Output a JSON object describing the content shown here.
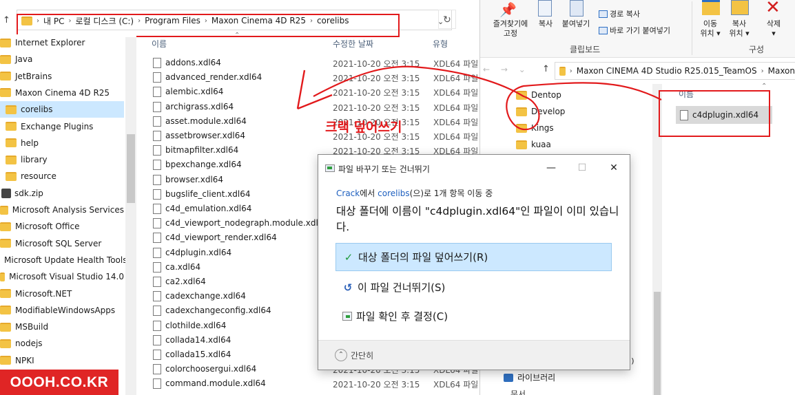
{
  "left": {
    "breadcrumbs": [
      "내 PC",
      "로컬 디스크 (C:)",
      "Program Files",
      "Maxon Cinema 4D R25",
      "corelibs"
    ],
    "search_partial": "",
    "nav_items": [
      {
        "label": "Internet Explorer",
        "selected": false
      },
      {
        "label": "Java",
        "selected": false
      },
      {
        "label": "JetBrains",
        "selected": false
      },
      {
        "label": "Maxon Cinema 4D R25",
        "selected": false
      },
      {
        "label": "corelibs",
        "selected": true
      },
      {
        "label": "Exchange Plugins",
        "selected": false
      },
      {
        "label": "help",
        "selected": false
      },
      {
        "label": "library",
        "selected": false
      },
      {
        "label": "resource",
        "selected": false
      },
      {
        "label": "sdk.zip",
        "selected": false
      },
      {
        "label": "Microsoft Analysis Services",
        "selected": false
      },
      {
        "label": "Microsoft Office",
        "selected": false
      },
      {
        "label": "Microsoft SQL Server",
        "selected": false
      },
      {
        "label": "Microsoft Update Health Tools",
        "selected": false
      },
      {
        "label": "Microsoft Visual Studio 14.0",
        "selected": false
      },
      {
        "label": "Microsoft.NET",
        "selected": false
      },
      {
        "label": "ModifiableWindowsApps",
        "selected": false
      },
      {
        "label": "MSBuild",
        "selected": false
      },
      {
        "label": "nodejs",
        "selected": false
      },
      {
        "label": "NPKI",
        "selected": false
      }
    ],
    "columns": {
      "name": "이름",
      "date": "수정한 날짜",
      "type": "유형"
    },
    "files": [
      {
        "name": "addons.xdl64",
        "date": "2021-10-20 오전 3:15",
        "type": "XDL64 파일"
      },
      {
        "name": "advanced_render.xdl64",
        "date": "2021-10-20 오전 3:15",
        "type": "XDL64 파일"
      },
      {
        "name": "alembic.xdl64",
        "date": "2021-10-20 오전 3:15",
        "type": "XDL64 파일"
      },
      {
        "name": "archigrass.xdl64",
        "date": "2021-10-20 오전 3:15",
        "type": "XDL64 파일"
      },
      {
        "name": "asset.module.xdl64",
        "date": "2021-10-20 오전 3:15",
        "type": "XDL64 파일"
      },
      {
        "name": "assetbrowser.xdl64",
        "date": "2021-10-20 오전 3:15",
        "type": "XDL64 파일"
      },
      {
        "name": "bitmapfilter.xdl64",
        "date": "2021-10-20 오전 3:15",
        "type": "XDL64 파일"
      },
      {
        "name": "bpexchange.xdl64",
        "date": "",
        "type": ""
      },
      {
        "name": "browser.xdl64",
        "date": "",
        "type": ""
      },
      {
        "name": "bugslife_client.xdl64",
        "date": "",
        "type": ""
      },
      {
        "name": "c4d_emulation.xdl64",
        "date": "",
        "type": ""
      },
      {
        "name": "c4d_viewport_nodegraph.module.xdl64",
        "date": "",
        "type": ""
      },
      {
        "name": "c4d_viewport_render.xdl64",
        "date": "",
        "type": ""
      },
      {
        "name": "c4dplugin.xdl64",
        "date": "",
        "type": ""
      },
      {
        "name": "ca.xdl64",
        "date": "",
        "type": ""
      },
      {
        "name": "ca2.xdl64",
        "date": "",
        "type": ""
      },
      {
        "name": "cadexchange.xdl64",
        "date": "",
        "type": ""
      },
      {
        "name": "cadexchangeconfig.xdl64",
        "date": "",
        "type": ""
      },
      {
        "name": "clothilde.xdl64",
        "date": "",
        "type": ""
      },
      {
        "name": "collada14.xdl64",
        "date": "",
        "type": ""
      },
      {
        "name": "collada15.xdl64",
        "date": "",
        "type": ""
      },
      {
        "name": "colorchoosergui.xdl64",
        "date": "2021-10-20 오전 3:15",
        "type": "XDL64 파일"
      },
      {
        "name": "command.module.xdl64",
        "date": "2021-10-20 오전 3:15",
        "type": "XDL64 파일"
      }
    ]
  },
  "right": {
    "ribbon": {
      "pin_label": "즐겨찾기에\n고정",
      "copy_label": "복사",
      "paste_label": "붙여넣기",
      "copy_path_label": "경로 복사",
      "paste_shortcut_label": "바로 가기 붙여넣기",
      "move_to_label": "이동\n위치 ▾",
      "copy_to_label": "복사\n위치 ▾",
      "delete_label": "삭제\n▾",
      "clipboard_group": "클립보드",
      "organize_group": "구성"
    },
    "breadcrumbs": [
      "Maxon CINEMA 4D Studio R25.015_TeamOS",
      "Maxon"
    ],
    "nav_items": [
      "Dentop",
      "Develop",
      "Kings",
      "kuaa"
    ],
    "list_header": "이름",
    "selected_file": "c4dplugin.xdl64",
    "library_label": "라이브러리",
    "drive_label": "Z:)",
    "last_item": "문서"
  },
  "annotation": {
    "text": "크랙 덮어쓰기",
    "color": "#e2191b"
  },
  "dialog": {
    "title": "파일 바꾸기 또는 건너뛰기",
    "progress_from": "Crack",
    "progress_mid": "에서 ",
    "progress_to": "corelibs",
    "progress_rest": "(으)로 1개 항목 이동 중",
    "message": "대상 폴더에 이름이 \"c4dplugin.xdl64\"인 파일이 이미 있습니다.",
    "option_replace": "대상 폴더의 파일 덮어쓰기(R)",
    "option_skip": "이 파일 건너뛰기(S)",
    "option_decide": "파일 확인 후 결정(C)",
    "less_details": "간단히",
    "minimize": "—",
    "maximize": "☐",
    "close": "✕"
  },
  "watermark": "OOOH.CO.KR"
}
